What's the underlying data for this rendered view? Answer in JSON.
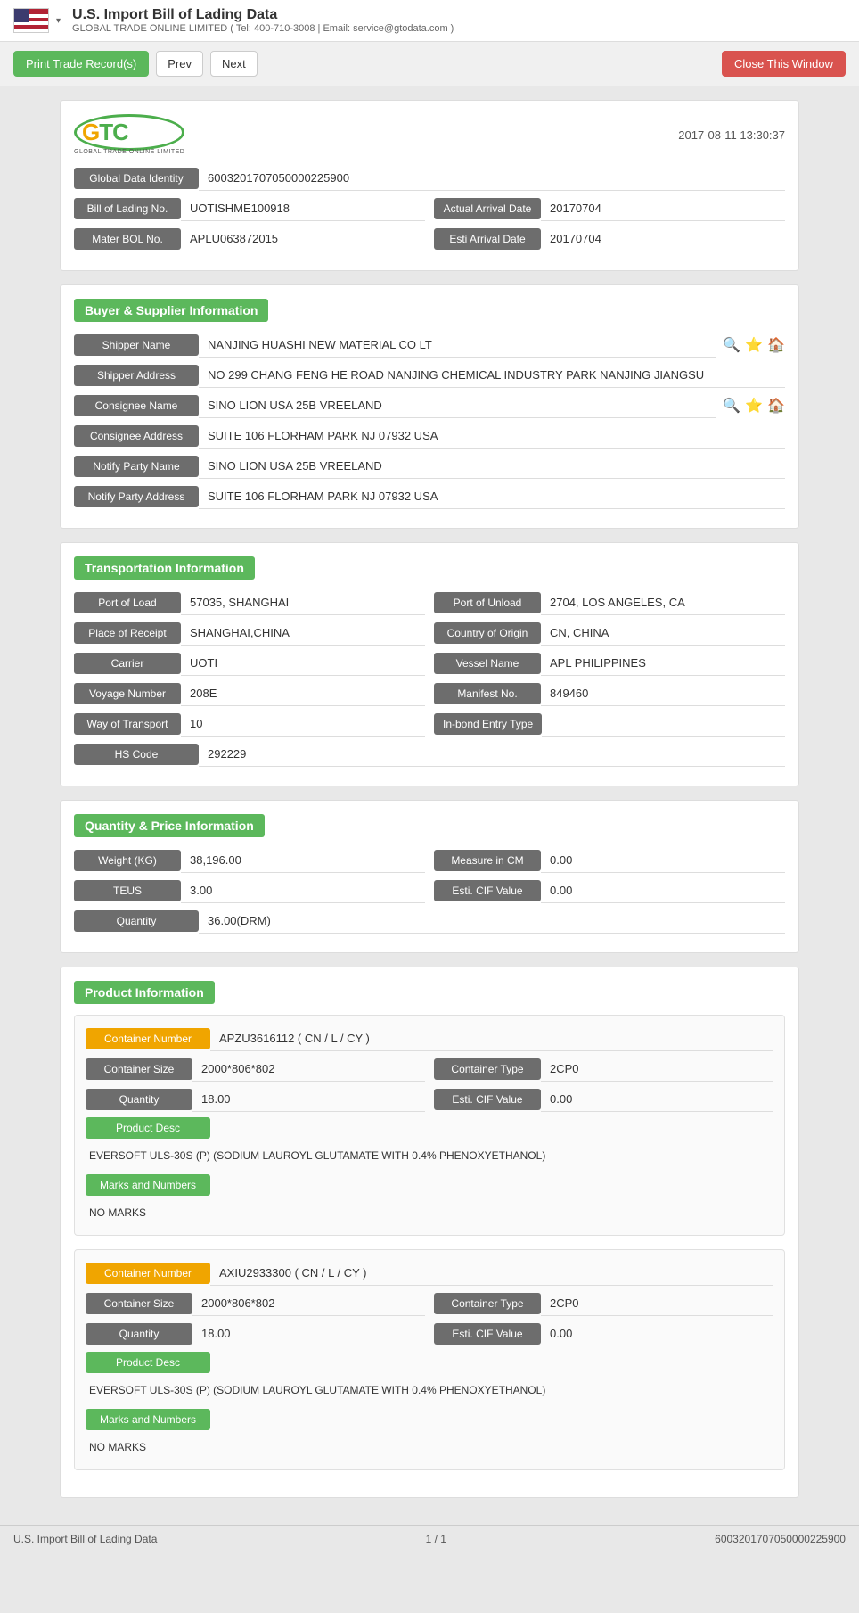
{
  "topbar": {
    "title": "U.S. Import Bill of Lading Data",
    "title_arrow": "▾",
    "subtitle": "GLOBAL TRADE ONLINE LIMITED ( Tel: 400-710-3008 | Email: service@gtodata.com )"
  },
  "toolbar": {
    "print_label": "Print Trade Record(s)",
    "prev_label": "Prev",
    "next_label": "Next",
    "close_label": "Close This Window"
  },
  "logo": {
    "text_g": "G",
    "text_t": "T",
    "text_c": "C",
    "subtitle": "GLOBAL TRADE ONLINE LIMITED"
  },
  "timestamp": "2017-08-11 13:30:37",
  "global_data_identity": {
    "label": "Global Data Identity",
    "value": "6003201707050000225900"
  },
  "bill_of_lading": {
    "label": "Bill of Lading No.",
    "value": "UOTISHME100918",
    "actual_arrival_label": "Actual Arrival Date",
    "actual_arrival_value": "20170704"
  },
  "master_bol": {
    "label": "Mater BOL No.",
    "value": "APLU063872015",
    "esti_arrival_label": "Esti Arrival Date",
    "esti_arrival_value": "20170704"
  },
  "buyer_supplier": {
    "section_title": "Buyer & Supplier Information",
    "shipper_name_label": "Shipper Name",
    "shipper_name_value": "NANJING HUASHI NEW MATERIAL CO LT",
    "shipper_address_label": "Shipper Address",
    "shipper_address_value": "NO 299 CHANG FENG HE ROAD NANJING CHEMICAL INDUSTRY PARK NANJING JIANGSU",
    "consignee_name_label": "Consignee Name",
    "consignee_name_value": "SINO LION USA 25B VREELAND",
    "consignee_address_label": "Consignee Address",
    "consignee_address_value": "SUITE 106 FLORHAM PARK NJ 07932 USA",
    "notify_party_name_label": "Notify Party Name",
    "notify_party_name_value": "SINO LION USA 25B VREELAND",
    "notify_party_address_label": "Notify Party Address",
    "notify_party_address_value": "SUITE 106 FLORHAM PARK NJ 07932 USA"
  },
  "transportation": {
    "section_title": "Transportation Information",
    "port_of_load_label": "Port of Load",
    "port_of_load_value": "57035, SHANGHAI",
    "port_of_unload_label": "Port of Unload",
    "port_of_unload_value": "2704, LOS ANGELES, CA",
    "place_of_receipt_label": "Place of Receipt",
    "place_of_receipt_value": "SHANGHAI,CHINA",
    "country_of_origin_label": "Country of Origin",
    "country_of_origin_value": "CN, CHINA",
    "carrier_label": "Carrier",
    "carrier_value": "UOTI",
    "vessel_name_label": "Vessel Name",
    "vessel_name_value": "APL PHILIPPINES",
    "voyage_number_label": "Voyage Number",
    "voyage_number_value": "208E",
    "manifest_no_label": "Manifest No.",
    "manifest_no_value": "849460",
    "way_of_transport_label": "Way of Transport",
    "way_of_transport_value": "10",
    "in_bond_entry_label": "In-bond Entry Type",
    "in_bond_entry_value": "",
    "hs_code_label": "HS Code",
    "hs_code_value": "292229"
  },
  "quantity_price": {
    "section_title": "Quantity & Price Information",
    "weight_label": "Weight (KG)",
    "weight_value": "38,196.00",
    "measure_label": "Measure in CM",
    "measure_value": "0.00",
    "teus_label": "TEUS",
    "teus_value": "3.00",
    "esti_cif_label": "Esti. CIF Value",
    "esti_cif_value": "0.00",
    "quantity_label": "Quantity",
    "quantity_value": "36.00(DRM)"
  },
  "product_information": {
    "section_title": "Product Information",
    "containers": [
      {
        "container_number_label": "Container Number",
        "container_number_value": "APZU3616112 ( CN / L / CY )",
        "container_size_label": "Container Size",
        "container_size_value": "2000*806*802",
        "container_type_label": "Container Type",
        "container_type_value": "2CP0",
        "quantity_label": "Quantity",
        "quantity_value": "18.00",
        "esti_cif_label": "Esti. CIF Value",
        "esti_cif_value": "0.00",
        "product_desc_label": "Product Desc",
        "product_desc_value": "EVERSOFT ULS-30S (P) (SODIUM LAUROYL GLUTAMATE WITH 0.4% PHENOXYETHANOL)",
        "marks_numbers_label": "Marks and Numbers",
        "marks_numbers_value": "NO MARKS"
      },
      {
        "container_number_label": "Container Number",
        "container_number_value": "AXIU2933300 ( CN / L / CY )",
        "container_size_label": "Container Size",
        "container_size_value": "2000*806*802",
        "container_type_label": "Container Type",
        "container_type_value": "2CP0",
        "quantity_label": "Quantity",
        "quantity_value": "18.00",
        "esti_cif_label": "Esti. CIF Value",
        "esti_cif_value": "0.00",
        "product_desc_label": "Product Desc",
        "product_desc_value": "EVERSOFT ULS-30S (P) (SODIUM LAUROYL GLUTAMATE WITH 0.4% PHENOXYETHANOL)",
        "marks_numbers_label": "Marks and Numbers",
        "marks_numbers_value": "NO MARKS"
      }
    ]
  },
  "footer": {
    "left": "U.S. Import Bill of Lading Data",
    "middle": "1 / 1",
    "right": "6003201707050000225900"
  }
}
